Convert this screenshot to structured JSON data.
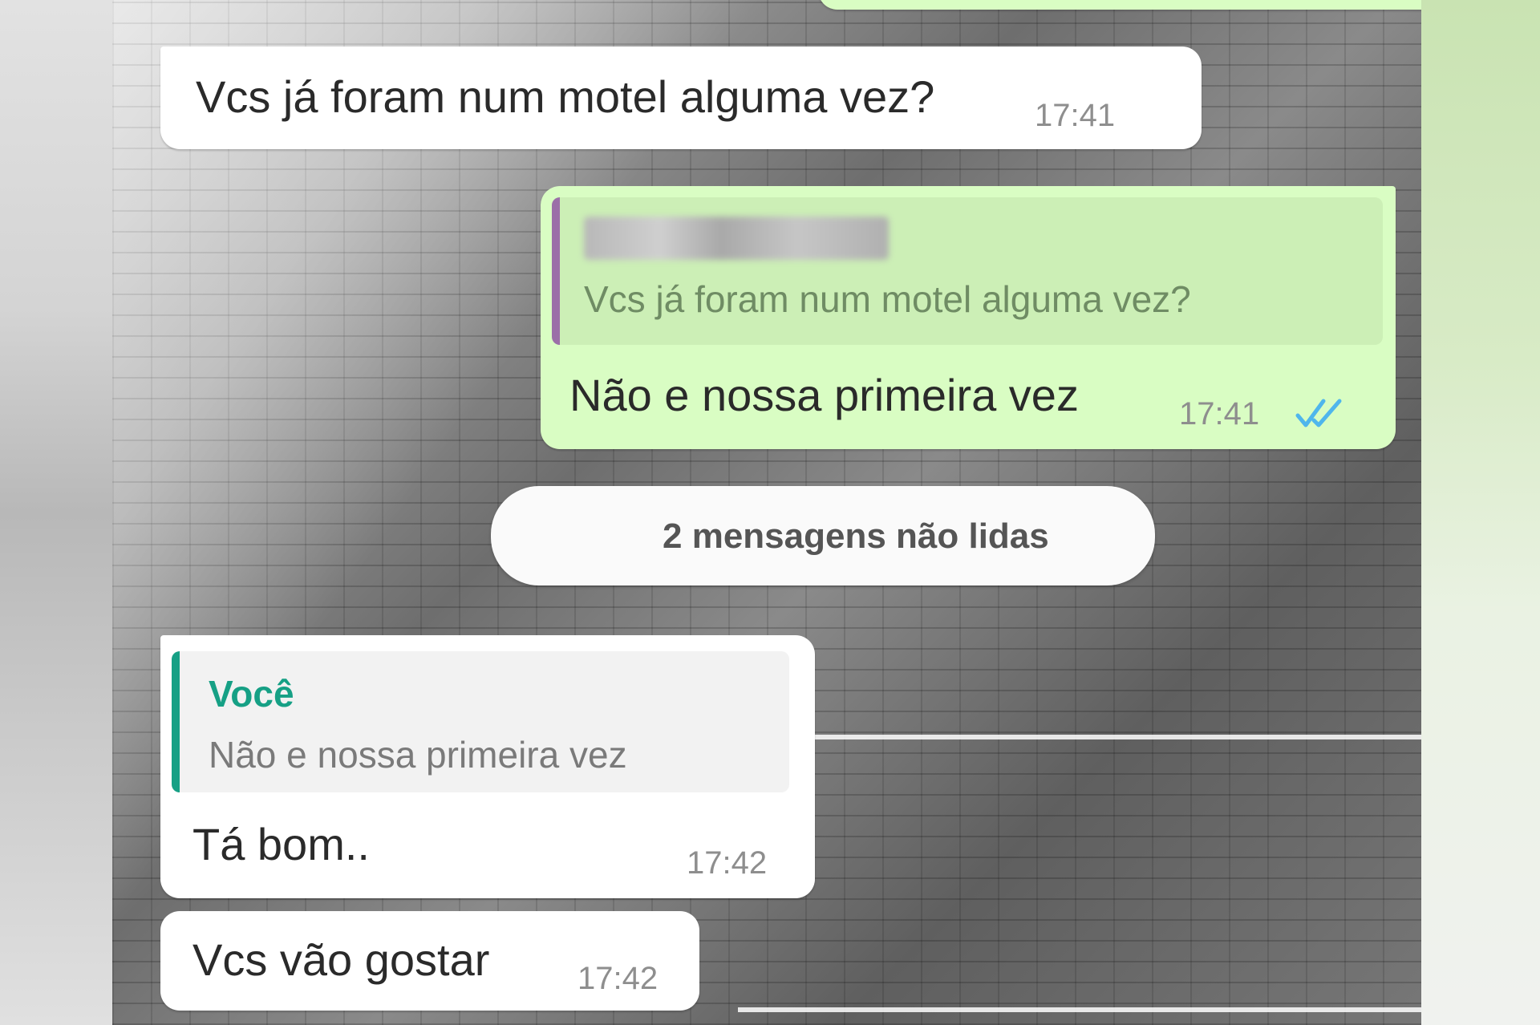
{
  "messages": [
    {
      "id": "m1",
      "direction": "incoming",
      "text": "Vcs já foram num motel alguma vez?",
      "time": "17:41"
    },
    {
      "id": "m2",
      "direction": "outgoing",
      "quote": {
        "text": "Vcs já foram num motel alguma vez?"
      },
      "text": "Não e nossa primeira vez",
      "time": "17:41",
      "read_receipt": "double-check-icon"
    },
    {
      "id": "m3",
      "direction": "incoming",
      "quote": {
        "author": "Você",
        "text": "Não e nossa primeira vez"
      },
      "text": "Tá bom..",
      "time": "17:42"
    },
    {
      "id": "m4",
      "direction": "incoming",
      "text": "Vcs vão gostar",
      "time": "17:42"
    }
  ],
  "unread_divider": {
    "label": "2 mensagens não lidas"
  },
  "colors": {
    "incoming_bubble": "#ffffff",
    "outgoing_bubble": "#d9fdc3",
    "quote_bar_self": "#16a085",
    "quote_bar_other": "#9b6fa8",
    "read_tick": "#4fb6ec"
  }
}
